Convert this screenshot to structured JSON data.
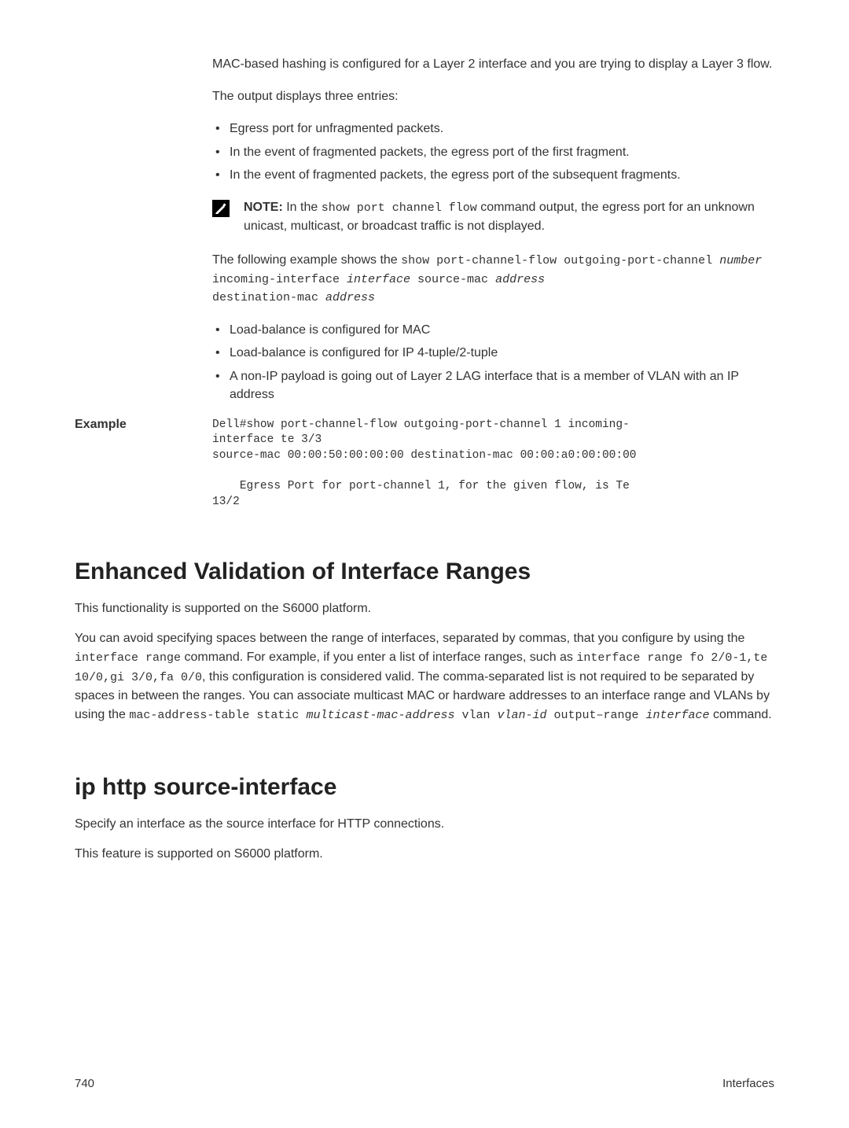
{
  "topSection": {
    "intro": "MAC-based hashing is configured for a Layer 2 interface and you are trying to display a Layer 3 flow.",
    "outputLine": "The output displays three entries:",
    "bullets1": [
      "Egress port for unfragmented packets.",
      "In the event of fragmented packets, the egress port of the first fragment.",
      "In the event of fragmented packets, the egress port of the subsequent fragments."
    ],
    "noteLabel": "NOTE:",
    "notePrefix": " In the ",
    "noteCmd": "show port channel flow",
    "noteSuffix": " command output, the egress port for an unknown unicast, multicast, or broadcast traffic is not displayed.",
    "examplePrefix": "The following example shows the ",
    "exampleCmd1": "show port-channel-flow outgoing-port-channel ",
    "exampleItalic1": "number",
    "exampleCmd2": " incoming-interface ",
    "exampleItalic2": "interface",
    "exampleCmd3": " source-mac ",
    "exampleItalic3": "address",
    "exampleCmd4": "destination-mac ",
    "exampleItalic4": "address",
    "bullets2": [
      "Load-balance is configured for MAC",
      "Load-balance is configured for IP 4-tuple/2-tuple",
      "A non-IP payload is going out of Layer 2 LAG interface that is a member of VLAN with an IP address"
    ]
  },
  "exampleLabel": "Example",
  "exampleCode": "Dell#show port-channel-flow outgoing-port-channel 1 incoming-\ninterface te 3/3\nsource-mac 00:00:50:00:00:00 destination-mac 00:00:a0:00:00:00\n\n    Egress Port for port-channel 1, for the given flow, is Te \n13/2",
  "heading1": "Enhanced Validation of Interface Ranges",
  "section1": {
    "p1": "This functionality is supported on the S6000 platform.",
    "p2a": "You can avoid specifying spaces between the range of interfaces, separated by commas, that you configure by using the ",
    "p2cmd1": "interface range",
    "p2b": " command. For example, if you enter a list of interface ranges, such as ",
    "p2cmd2": "interface range fo 2/0-1,te 10/0,gi 3/0,fa 0/0",
    "p2c": ", this configuration is considered valid. The comma-separated list is not required to be separated by spaces in between the ranges. You can associate multicast MAC or hardware addresses to an interface range and VLANs by using the ",
    "p2cmd3": "mac-address-table static ",
    "p2italic1": "multicast-mac-address",
    "p2cmd4": " vlan ",
    "p2italic2": "vlan-id",
    "p2cmd5": " output–range ",
    "p2italic3": "interface",
    "p2d": " command."
  },
  "heading2": "ip http source-interface",
  "section2": {
    "p1": "Specify an interface as the source interface for HTTP connections.",
    "p2": "This feature is supported on S6000 platform."
  },
  "footer": {
    "pageNum": "740",
    "label": "Interfaces"
  }
}
